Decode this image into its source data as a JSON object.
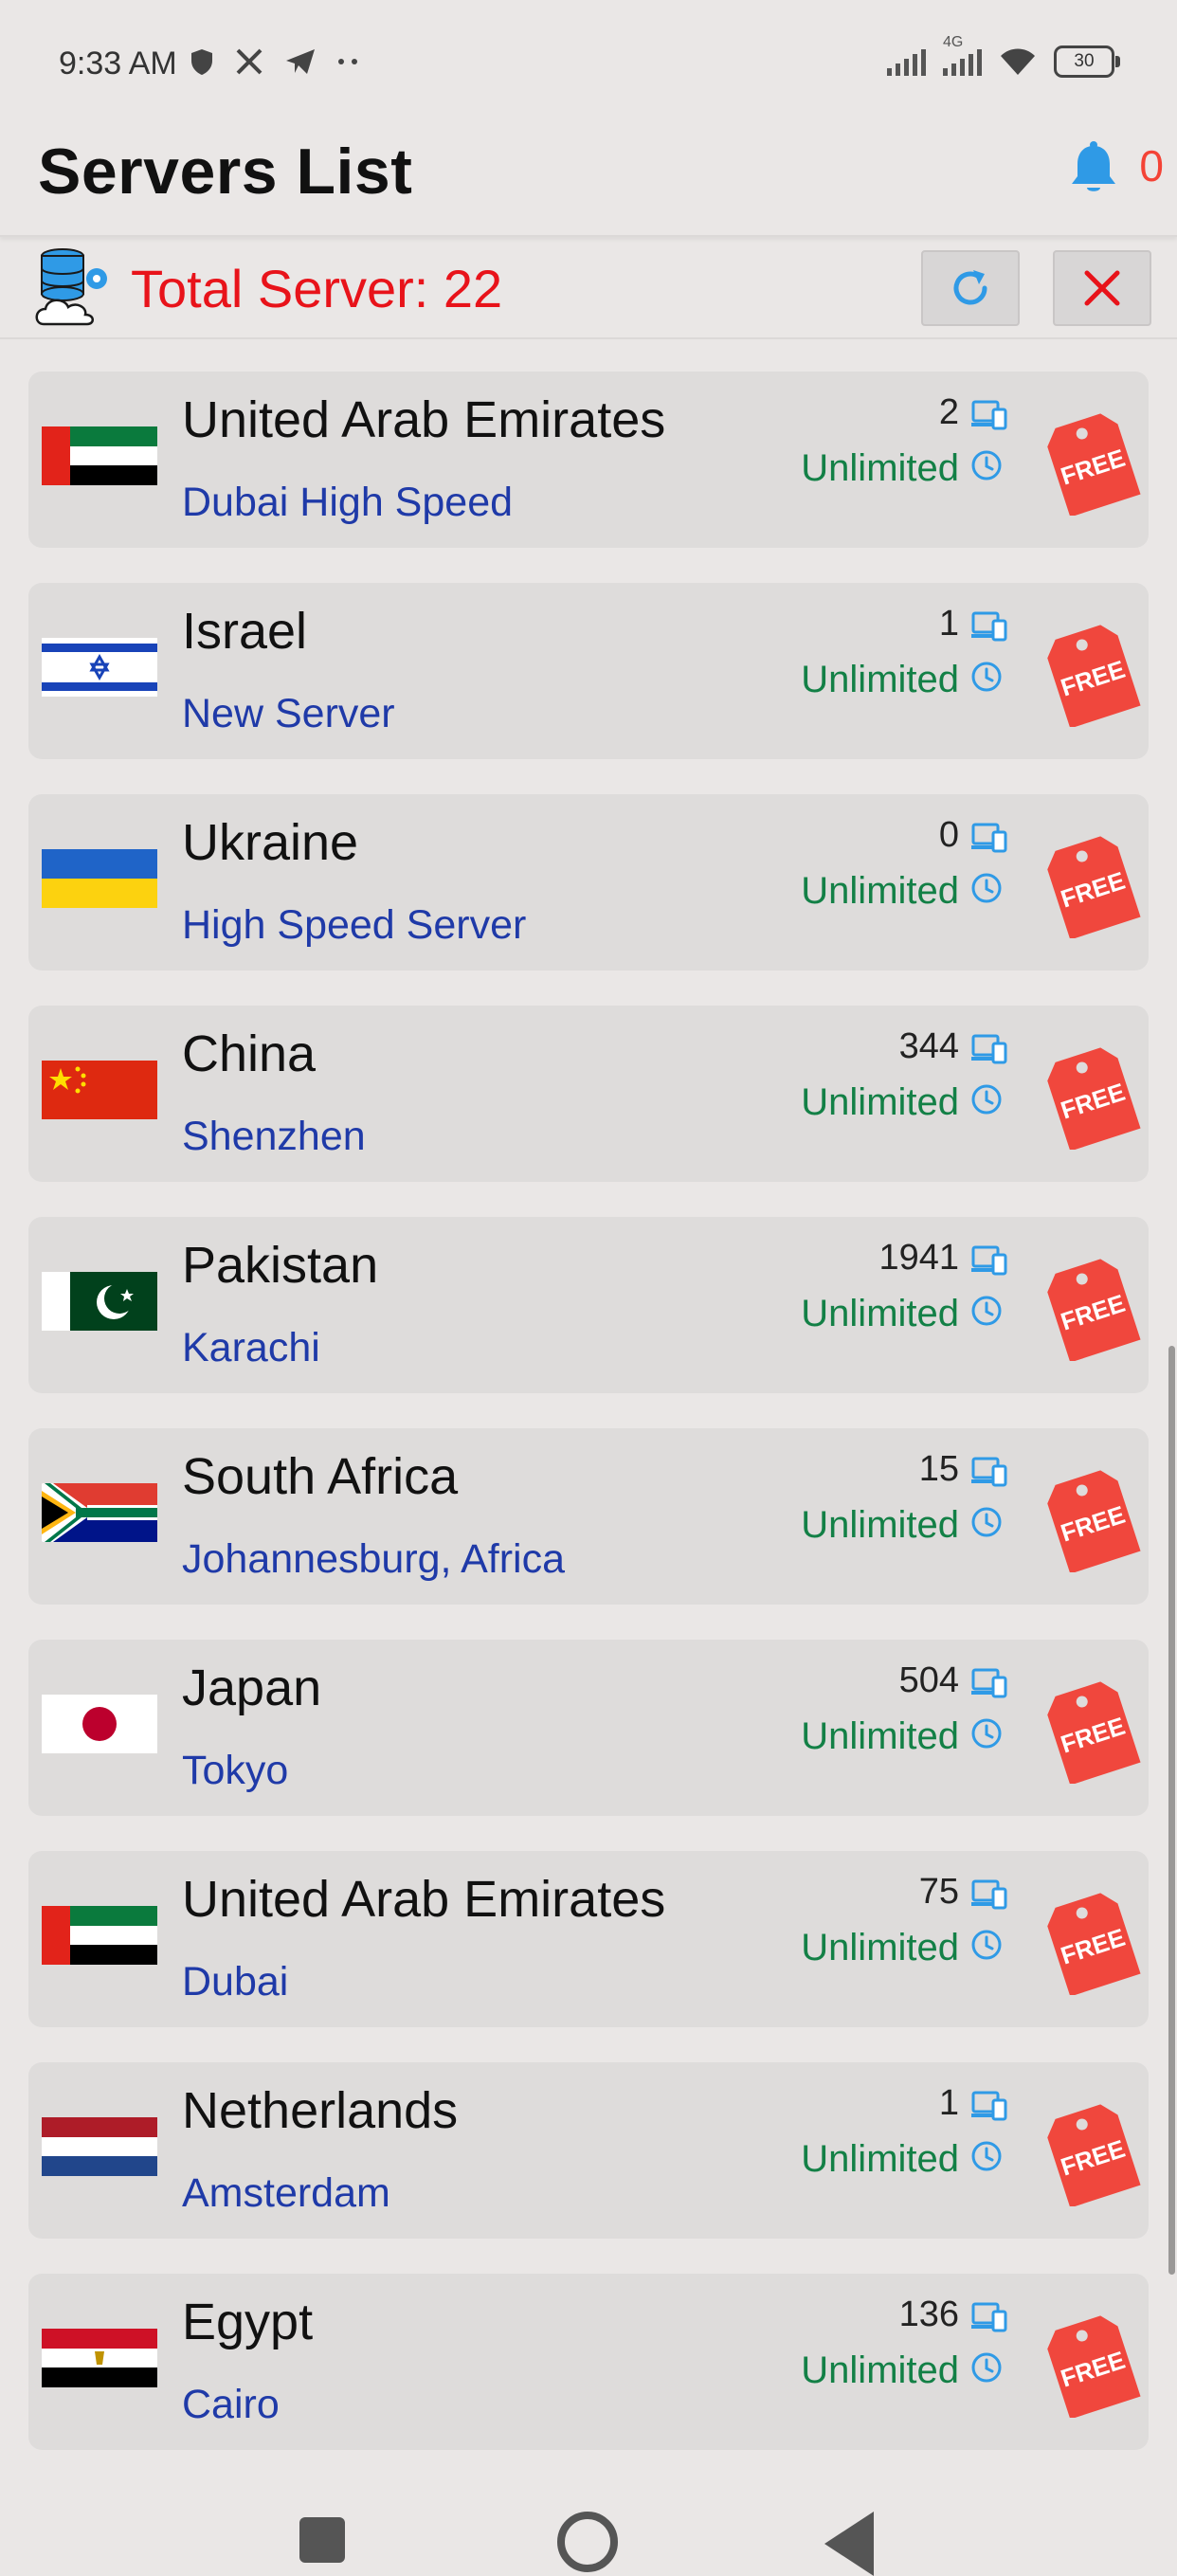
{
  "status_bar": {
    "time": "9:33 AM",
    "network_label": "4G",
    "battery": "30",
    "icons": [
      "shield-icon",
      "x-logo-icon",
      "telegram-icon",
      "more-dots-icon",
      "signal-icon",
      "signal-4g-icon",
      "wifi-icon",
      "battery-icon"
    ]
  },
  "header": {
    "title": "Servers List",
    "notification_count": "0",
    "icon": "bell-icon"
  },
  "total": {
    "label": "Total Server: 22",
    "icon": "database-cloud-icon",
    "refresh_icon": "refresh-icon",
    "close_icon": "close-icon"
  },
  "colors": {
    "accent_red": "#e8131a",
    "city_blue": "#1f3aa8",
    "limit_green": "#138046",
    "icon_blue": "#2f9ae6",
    "tag_red": "#f0473d"
  },
  "servers": [
    {
      "country": "United Arab Emirates",
      "city": "Dubai High Speed",
      "users": "2",
      "limit": "Unlimited",
      "flag": "uae",
      "badge": "FREE"
    },
    {
      "country": "Israel",
      "city": "New Server",
      "users": "1",
      "limit": "Unlimited",
      "flag": "israel",
      "badge": "FREE"
    },
    {
      "country": "Ukraine",
      "city": "High Speed Server",
      "users": "0",
      "limit": "Unlimited",
      "flag": "ukraine",
      "badge": "FREE"
    },
    {
      "country": "China",
      "city": "Shenzhen",
      "users": "344",
      "limit": "Unlimited",
      "flag": "china",
      "badge": "FREE"
    },
    {
      "country": "Pakistan",
      "city": "Karachi",
      "users": "1941",
      "limit": "Unlimited",
      "flag": "pakistan",
      "badge": "FREE"
    },
    {
      "country": "South Africa",
      "city": "Johannesburg, Africa",
      "users": "15",
      "limit": "Unlimited",
      "flag": "southafrica",
      "badge": "FREE"
    },
    {
      "country": "Japan",
      "city": "Tokyo",
      "users": "504",
      "limit": "Unlimited",
      "flag": "japan",
      "badge": "FREE"
    },
    {
      "country": "United Arab Emirates",
      "city": "Dubai",
      "users": "75",
      "limit": "Unlimited",
      "flag": "uae",
      "badge": "FREE"
    },
    {
      "country": "Netherlands",
      "city": "Amsterdam",
      "users": "1",
      "limit": "Unlimited",
      "flag": "netherlands",
      "badge": "FREE"
    },
    {
      "country": "Egypt",
      "city": "Cairo",
      "users": "136",
      "limit": "Unlimited",
      "flag": "egypt",
      "badge": "FREE"
    }
  ]
}
